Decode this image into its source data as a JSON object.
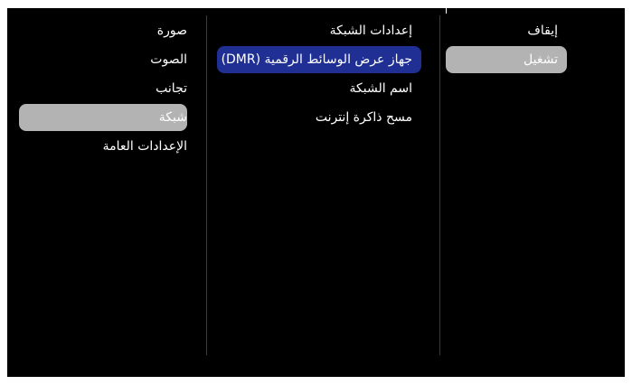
{
  "menu": {
    "items": [
      {
        "label": "صورة",
        "selected": false
      },
      {
        "label": "الصوت",
        "selected": false
      },
      {
        "label": "تجانب",
        "selected": false
      },
      {
        "label": "شبكة",
        "selected": true
      },
      {
        "label": "الإعدادات العامة",
        "selected": false
      }
    ]
  },
  "network_menu": {
    "items": [
      {
        "label": "إعدادات الشبكة",
        "selected": false
      },
      {
        "label": "جهاز عرض الوسائط الرقمية (DMR)",
        "selected": true
      },
      {
        "label": "اسم الشبكة",
        "selected": false
      },
      {
        "label": "مسح ذاكرة إنترنت",
        "selected": false
      }
    ]
  },
  "dmr_options": {
    "items": [
      {
        "label": "إيقاف",
        "selected": false
      },
      {
        "label": "تشغيل",
        "selected": true
      }
    ]
  },
  "colors": {
    "background": "#000000",
    "selected_blue": "#1f2f93",
    "selected_grey": "#b3b3b3",
    "text": "#ffffff"
  }
}
